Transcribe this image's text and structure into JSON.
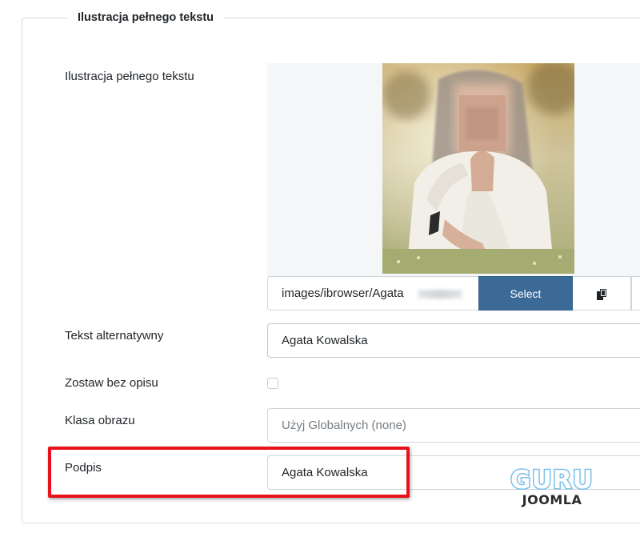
{
  "section": {
    "legend": "Ilustracja pełnego tekstu"
  },
  "fields": {
    "image": {
      "label": "Ilustracja pełnego tekstu",
      "path_value": "images/ibrowser/Agata",
      "select_label": "Select",
      "copy_icon": "copy-icon"
    },
    "alt_text": {
      "label": "Tekst alternatywny",
      "value": "Agata Kowalska"
    },
    "no_description": {
      "label": "Zostaw bez opisu",
      "checked": false
    },
    "image_class": {
      "label": "Klasa obrazu",
      "placeholder": "Użyj Globalnych (none)"
    },
    "caption": {
      "label": "Podpis",
      "value": "Agata Kowalska"
    }
  },
  "watermark": {
    "line1": "GURU",
    "line2": "JOOMLA"
  },
  "colors": {
    "select_button": "#3c6a96",
    "highlight": "#e8121c",
    "watermark_guru": "#7cc0ea"
  }
}
